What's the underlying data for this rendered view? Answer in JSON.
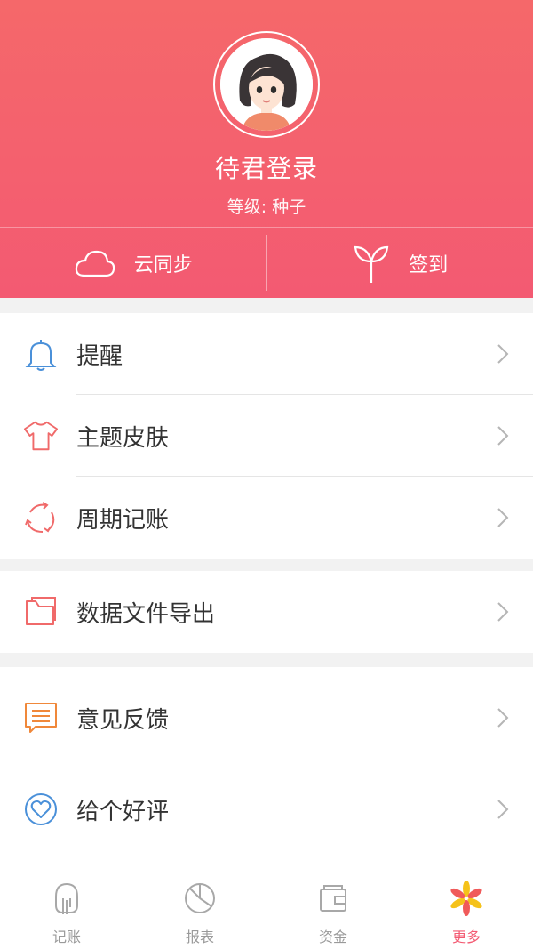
{
  "profile": {
    "username": "待君登录",
    "level": "等级: 种子",
    "avatar_icon": "girl-avatar-icon"
  },
  "actions": {
    "sync_label": "云同步",
    "sync_icon": "cloud-icon",
    "checkin_label": "签到",
    "checkin_icon": "sprout-icon"
  },
  "menu": {
    "group1": [
      {
        "label": "提醒",
        "icon": "bell-icon"
      },
      {
        "label": "主题皮肤",
        "icon": "tshirt-icon"
      },
      {
        "label": "周期记账",
        "icon": "cycle-icon"
      }
    ],
    "group2": [
      {
        "label": "数据文件导出",
        "icon": "folder-icon"
      }
    ],
    "group3": [
      {
        "label": "意见反馈",
        "icon": "feedback-icon"
      },
      {
        "label": "给个好评",
        "icon": "heart-icon"
      }
    ]
  },
  "tabs": [
    {
      "label": "记账",
      "icon": "hand-pen-icon",
      "active": false
    },
    {
      "label": "报表",
      "icon": "pie-chart-icon",
      "active": false
    },
    {
      "label": "资金",
      "icon": "wallet-icon",
      "active": false
    },
    {
      "label": "更多",
      "icon": "flower-icon",
      "active": true
    }
  ],
  "colors": {
    "header_top": "#f5686a",
    "header_bottom": "#f35a72",
    "accent": "#f35a72",
    "bell": "#4a90d9",
    "tshirt": "#f06a6a",
    "cycle": "#f06a6a",
    "folder": "#f06a6a",
    "feedback": "#f0883a",
    "heart": "#4a90d9"
  }
}
